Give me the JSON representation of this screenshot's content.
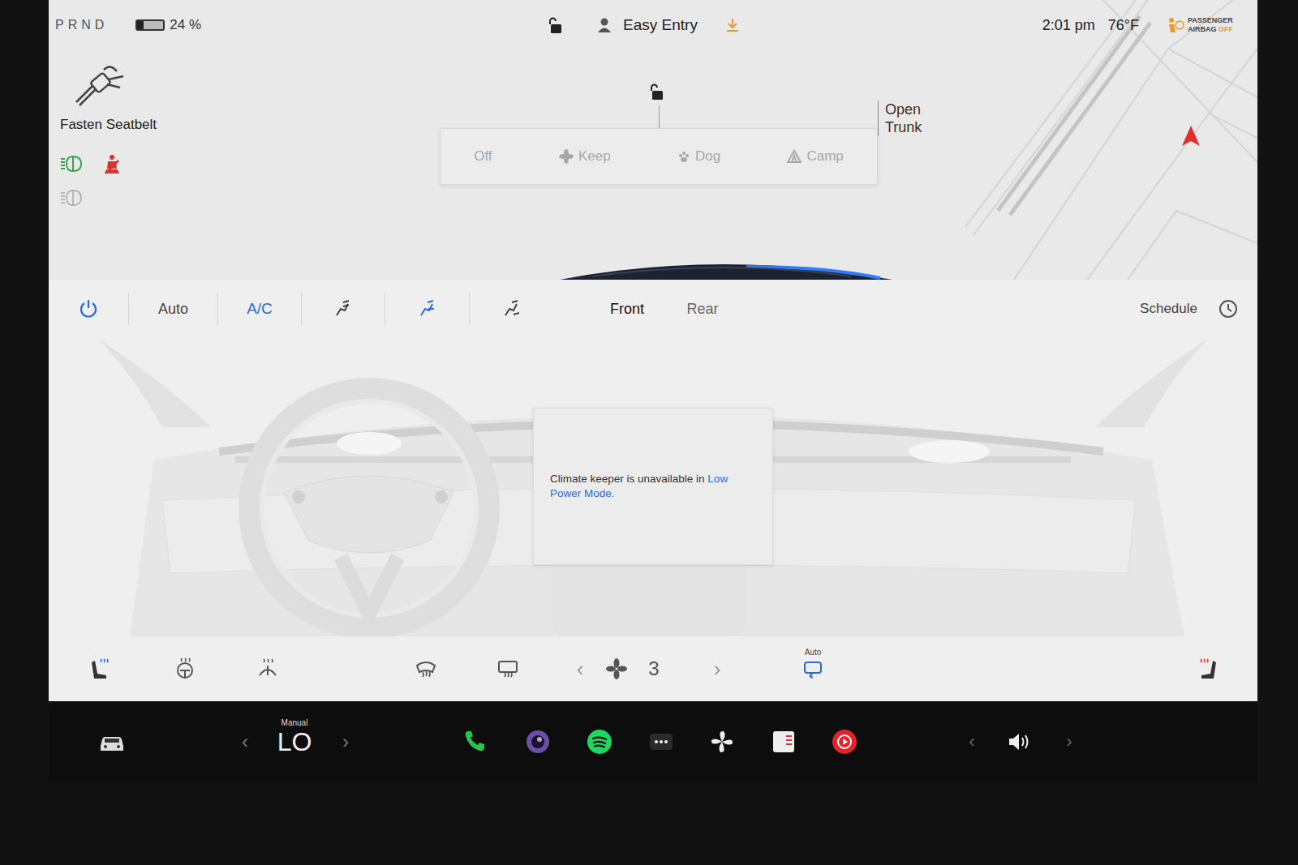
{
  "status_bar": {
    "gears": "PRND",
    "battery": {
      "reading": "24 %",
      "level": 0.24
    },
    "locked": false,
    "profile": "Easy Entry",
    "time": "2:01 pm",
    "temperature": "76°F",
    "airbag": {
      "line1": "PASSENGER",
      "line2": "AIRBAG",
      "state": "OFF"
    }
  },
  "alerts": {
    "seatbelt": "Fasten Seatbelt",
    "indicators": [
      {
        "kind": "headlights",
        "on": true,
        "color": "#2fa84f"
      },
      {
        "kind": "seatbelt",
        "on": true,
        "color": "#e0312f"
      },
      {
        "kind": "auto-high-beam",
        "on": false,
        "color": "#9a9a9a"
      }
    ]
  },
  "car_view": {
    "locked": false,
    "trunk_line1": "Open",
    "trunk_line2": "Trunk",
    "modes": [
      {
        "label": "Off",
        "kind": "off",
        "selected": false,
        "disabled": true
      },
      {
        "label": "Keep",
        "kind": "keep",
        "selected": false,
        "disabled": true
      },
      {
        "label": "Dog",
        "kind": "dog",
        "selected": false,
        "disabled": true
      },
      {
        "label": "Camp",
        "kind": "camp",
        "selected": false,
        "disabled": true
      }
    ]
  },
  "climate": {
    "power_on": true,
    "auto": {
      "label": "Auto",
      "selected": false
    },
    "ac": {
      "label": "A/C",
      "selected": true
    },
    "airflow": [
      {
        "selected": false
      },
      {
        "selected": true
      },
      {
        "selected": false
      }
    ],
    "zones": [
      {
        "label": "Front",
        "selected": true
      },
      {
        "label": "Rear",
        "selected": false
      }
    ],
    "schedule": "Schedule",
    "message": "Climate keeper is unavailable in ",
    "message_link": "Low Power Mode.",
    "controls": [
      {
        "kind": "seat-left",
        "on": true,
        "color": "#2a6ae0"
      },
      {
        "kind": "steering-heat",
        "on": false,
        "color": "#555555"
      },
      {
        "kind": "wiper-defrost",
        "on": false,
        "color": "#555555"
      },
      {
        "kind": "front-defrost",
        "on": false,
        "color": "#555555"
      },
      {
        "kind": "rear-defrost",
        "on": false,
        "color": "#555555"
      }
    ],
    "fan": {
      "prev": "‹",
      "speed": "3",
      "next": "›"
    },
    "recirculate": {
      "label": "Auto",
      "on": true
    },
    "seat_right": {
      "on": true,
      "color": "#e0312f"
    }
  },
  "dock": {
    "temp_mode": "Manual",
    "temp_prev": "‹",
    "temperature": "LO",
    "temp_next": "›",
    "apps": [
      {
        "kind": "phone"
      },
      {
        "kind": "camera"
      },
      {
        "kind": "spotify"
      },
      {
        "kind": "more"
      },
      {
        "kind": "fan"
      },
      {
        "kind": "notes"
      },
      {
        "kind": "youtube"
      }
    ],
    "volume_prev": "‹",
    "volume_next": "›"
  }
}
